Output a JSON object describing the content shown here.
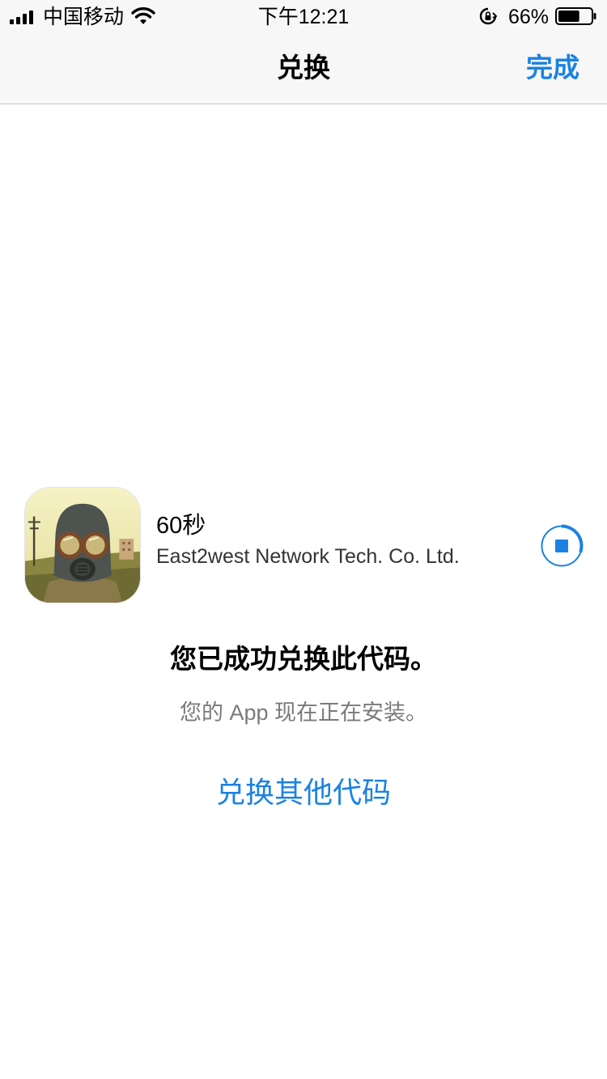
{
  "status_bar": {
    "carrier": "中国移动",
    "time": "下午12:21",
    "battery_percent": "66%",
    "battery_level": 0.66,
    "icons": [
      "signal-icon",
      "wifi-icon",
      "rotation-lock-icon",
      "battery-icon"
    ]
  },
  "nav": {
    "title": "兑换",
    "done_label": "完成"
  },
  "app": {
    "name": "60秒",
    "developer": "East2west Network Tech. Co. Ltd.",
    "install_progress": 0.3
  },
  "message": {
    "title": "您已成功兑换此代码。",
    "subtitle": "您的 App 现在正在安装。",
    "redeem_other_label": "兑换其他代码"
  },
  "colors": {
    "accent": "#1a82e2",
    "bar_background": "#f7f7f7",
    "subtitle_gray": "#7a7a7a"
  }
}
